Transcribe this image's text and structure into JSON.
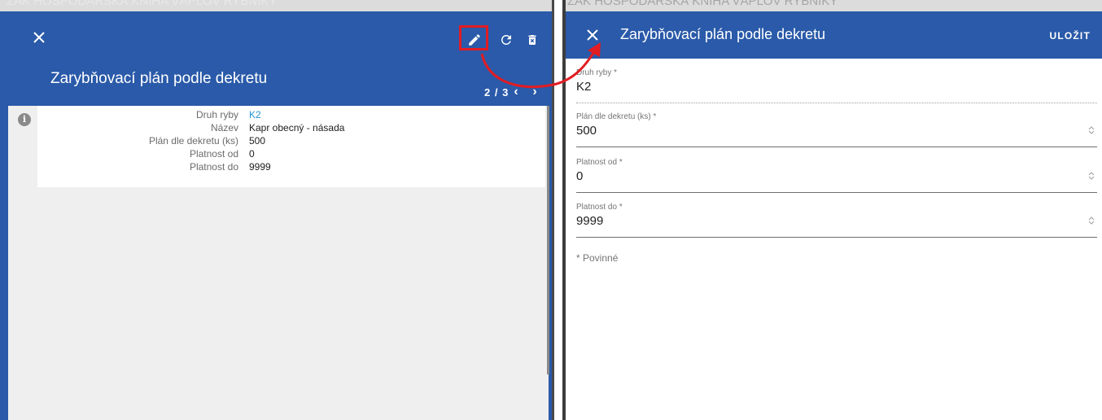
{
  "left": {
    "ghost_text": "ZAK HOSPODÁŘSKÁ KNIHA   VÁPLOV   RYBNÍKY",
    "title": "Zarybňovací plán podle dekretu",
    "pager": "2 / 3",
    "fields": [
      {
        "label": "Druh ryby",
        "value": "K2",
        "is_link": true
      },
      {
        "label": "Název",
        "value": "Kapr obecný - násada",
        "is_link": false
      },
      {
        "label": "Plán dle dekretu (ks)",
        "value": "500",
        "is_link": false
      },
      {
        "label": "Platnost od",
        "value": "0",
        "is_link": false
      },
      {
        "label": "Platnost do",
        "value": "9999",
        "is_link": false
      }
    ],
    "icons": [
      "close-icon",
      "edit-pencil-icon",
      "refresh-icon",
      "delete-icon",
      "info-icon",
      "chevron-left-icon",
      "chevron-right-icon"
    ]
  },
  "right": {
    "ghost_text": "ZAK HOSPODÁŘSKÁ KNIHA   VÁPLOV   RYBNÍKY",
    "title": "Zarybňovací plán podle dekretu",
    "save_label": "ULOŽIT",
    "fields": [
      {
        "label": "Druh ryby *",
        "value": "K2"
      },
      {
        "label": "Plán dle dekretu (ks) *",
        "value": "500"
      },
      {
        "label": "Platnost od *",
        "value": "0"
      },
      {
        "label": "Platnost do *",
        "value": "9999"
      }
    ],
    "required_note": "* Povinné"
  },
  "colors": {
    "toolbar_blue": "#2a5aa9",
    "link_blue": "#2196d3",
    "annotation_red": "#e21c23"
  }
}
